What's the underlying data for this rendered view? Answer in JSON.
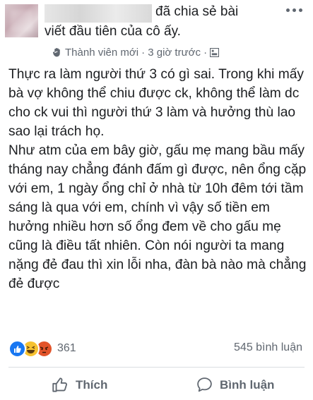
{
  "post": {
    "headline_line1": "đã chia sẻ bài",
    "headline_line2": "viết đầu tiên của cô ấy.",
    "badge": "Thành viên mới",
    "time": "· 3 giờ trước ·",
    "body": "Thực ra làm người thứ 3 có gì sai. Trong khi mấy bà vợ không thể chiu được ck, không thể làm dc cho ck vui thì người thứ 3 làm và hưởng thù lao sao lại trách họ.\nNhư atm của em bây giờ, gấu mẹ mang bầu mấy tháng nay chẳng đánh đấm gì được, nên ổng cặp với em, 1 ngày ổng chỉ ở nhà từ 10h đêm tới tầm sáng là qua với em, chính vì vậy số tiền em hưởng nhiều hơn số ổng đem về cho gấu mẹ cũng là điều tất nhiên. Còn nói người ta mang nặng đẻ đau thì xin lỗi nha, đàn bà nào mà chẳng đẻ được"
  },
  "stats": {
    "reaction_count": "361",
    "comment_count": "545 bình luận",
    "reaction_icons": [
      "like-icon",
      "haha-icon",
      "angry-icon"
    ]
  },
  "actions": {
    "like_label": "Thích",
    "comment_label": "Bình luận"
  },
  "colors": {
    "text": "#1c1e21",
    "secondary": "#606770",
    "like_blue": "#1877f2",
    "haha_yellow": "#f7c230",
    "angry_orange": "#e2542a"
  }
}
